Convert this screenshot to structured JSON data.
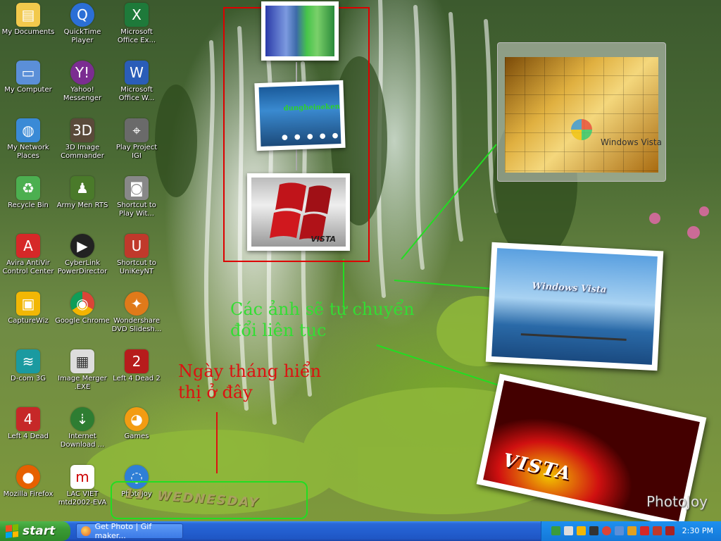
{
  "desktop_icons": [
    {
      "label": "My Documents",
      "icon": "folder-icon",
      "color": "#f2c94c"
    },
    {
      "label": "QuickTime\nPlayer",
      "icon": "quicktime-icon",
      "color": "#2b6fd6"
    },
    {
      "label": "Microsoft\nOffice Ex...",
      "icon": "excel-icon",
      "color": "#1e7a3a"
    },
    {
      "label": "My Computer",
      "icon": "computer-icon",
      "color": "#5b8fd8"
    },
    {
      "label": "Yahoo!\nMessenger",
      "icon": "yahoo-icon",
      "color": "#7b2d91"
    },
    {
      "label": "Microsoft\nOffice W...",
      "icon": "word-icon",
      "color": "#2a5db8"
    },
    {
      "label": "My Network\nPlaces",
      "icon": "network-icon",
      "color": "#3a8ad6"
    },
    {
      "label": "3D Image\nCommander",
      "icon": "3d-image-icon",
      "color": "#5a4a3a"
    },
    {
      "label": "Play Project\nIGI",
      "icon": "igi-icon",
      "color": "#6a6a6a"
    },
    {
      "label": "Recycle Bin",
      "icon": "recycle-bin-icon",
      "color": "#4caf50"
    },
    {
      "label": "Army Men RTS",
      "icon": "army-men-icon",
      "color": "#4a7a2a"
    },
    {
      "label": "Shortcut to\nPlay Wit...",
      "icon": "camera-icon",
      "color": "#888888"
    },
    {
      "label": "Avira AntiVir\nControl Center",
      "icon": "avira-icon",
      "color": "#d62828"
    },
    {
      "label": "CyberLink\nPowerDirector",
      "icon": "powerdirector-icon",
      "color": "#222222"
    },
    {
      "label": "Shortcut to\nUniKeyNT",
      "icon": "unikey-icon",
      "color": "#c0392b"
    },
    {
      "label": "CaptureWiz",
      "icon": "capturewiz-icon",
      "color": "#f2b705"
    },
    {
      "label": "Google Chrome",
      "icon": "chrome-icon",
      "color": "#db4437"
    },
    {
      "label": "Wondershare\nDVD Slidesh...",
      "icon": "wondershare-icon",
      "color": "#e07a1a"
    },
    {
      "label": "D-com 3G",
      "icon": "dcom-icon",
      "color": "#1a9aa0"
    },
    {
      "label": "Image Merger\n.EXE",
      "icon": "image-merger-icon",
      "color": "#dddddd"
    },
    {
      "label": "Left 4 Dead 2",
      "icon": "left4dead2-icon",
      "color": "#b71c1c"
    },
    {
      "label": "Left 4 Dead",
      "icon": "left4dead-icon",
      "color": "#c62828"
    },
    {
      "label": "Internet\nDownload ...",
      "icon": "idm-icon",
      "color": "#2e7d32"
    },
    {
      "label": "Games",
      "icon": "games-icon",
      "color": "#f39c12"
    },
    {
      "label": "Mozilla Firefox",
      "icon": "firefox-icon",
      "color": "#e66000"
    },
    {
      "label": "LAC VIET\nmtd2002-EVA",
      "icon": "lacviet-icon",
      "color": "#ffffff"
    },
    {
      "label": "PhotoJoy",
      "icon": "photojoy-icon",
      "color": "#2f7fd6"
    }
  ],
  "slideshow": {
    "thumb1_caption": "",
    "thumb2_caption": "dungheineken",
    "thumb3_caption": "VISTA"
  },
  "vista_tile": {
    "label": "Windows Vista"
  },
  "photo_card_1": {
    "label": "Windows Vista"
  },
  "photo_card_2": {
    "label": "VISTA"
  },
  "annotations": {
    "auto_change": "Các ảnh sẽ tự chuyển\nđổi liên tục",
    "date_note": "Ngày tháng hiển\nthị ở đây"
  },
  "date_display": "11. WEDNESDAY",
  "watermark": "PhotoJoy",
  "taskbar": {
    "start_label": "start",
    "task_label": "Get Photo | Gif maker...",
    "clock": "2:30 PM"
  },
  "colors": {
    "annotation_green": "#33dd33",
    "annotation_red": "#dd1111",
    "highlight_red": "#dd0000",
    "highlight_green": "#22dd22",
    "taskbar_blue": "#235fd0",
    "start_green": "#3a9a34"
  }
}
